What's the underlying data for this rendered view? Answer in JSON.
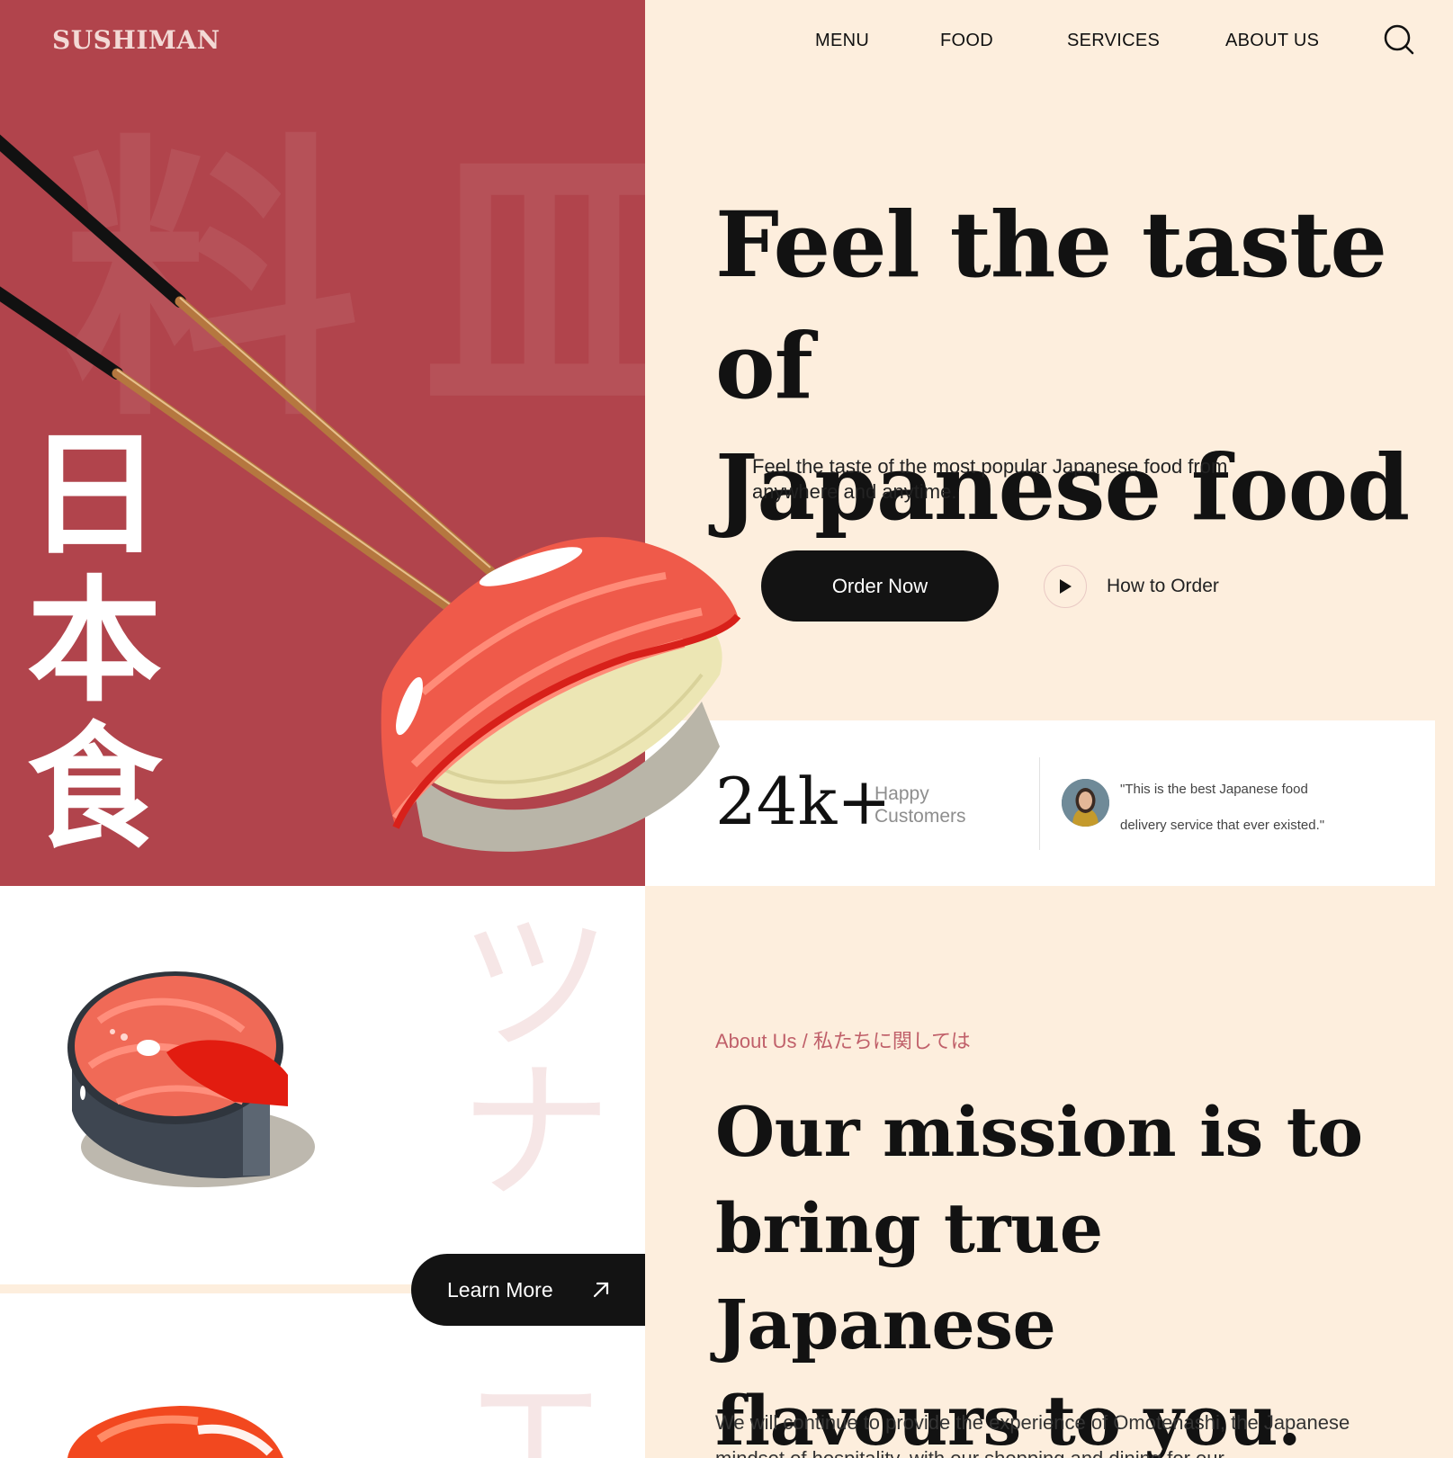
{
  "brand": {
    "logo": "SUSHIMAN"
  },
  "nav": {
    "items": [
      "MENU",
      "FOOD",
      "SERVICES",
      "ABOUT US"
    ],
    "search_icon": "search-icon"
  },
  "hero": {
    "kanji_vertical": [
      "日",
      "本",
      "食"
    ],
    "bg_kanji": [
      "料",
      "皿"
    ],
    "title_line1": "Feel the taste of",
    "title_line2": "Japanese food",
    "subtitle": "Feel the taste of the most popular Japanese food from anywhere and anytime.",
    "order_button": "Order Now",
    "how_to_order": "How to Order"
  },
  "stats": {
    "number": "24k+",
    "label_line1": "Happy",
    "label_line2": "Customers",
    "testimonial": "\"This is the best Japanese food delivery service that ever existed.\""
  },
  "about": {
    "kicker": "About Us / 私たちに関しては",
    "title_line1": "Our mission is to",
    "title_line2": "bring true Japanese",
    "title_line3": "flavours to you.",
    "body": "We will continue to provide the experience of Omotenashi, the Japanese mindset of hospitality, with our shopping and dining for our"
  },
  "food_gallery": {
    "katakana": [
      "ツ",
      "ナ",
      "エ"
    ],
    "learn_more": "Learn More"
  },
  "colors": {
    "brand_red": "#B1444C",
    "cream": "#FDEEDD",
    "dark": "#131313",
    "accent_text": "#C0606A"
  }
}
